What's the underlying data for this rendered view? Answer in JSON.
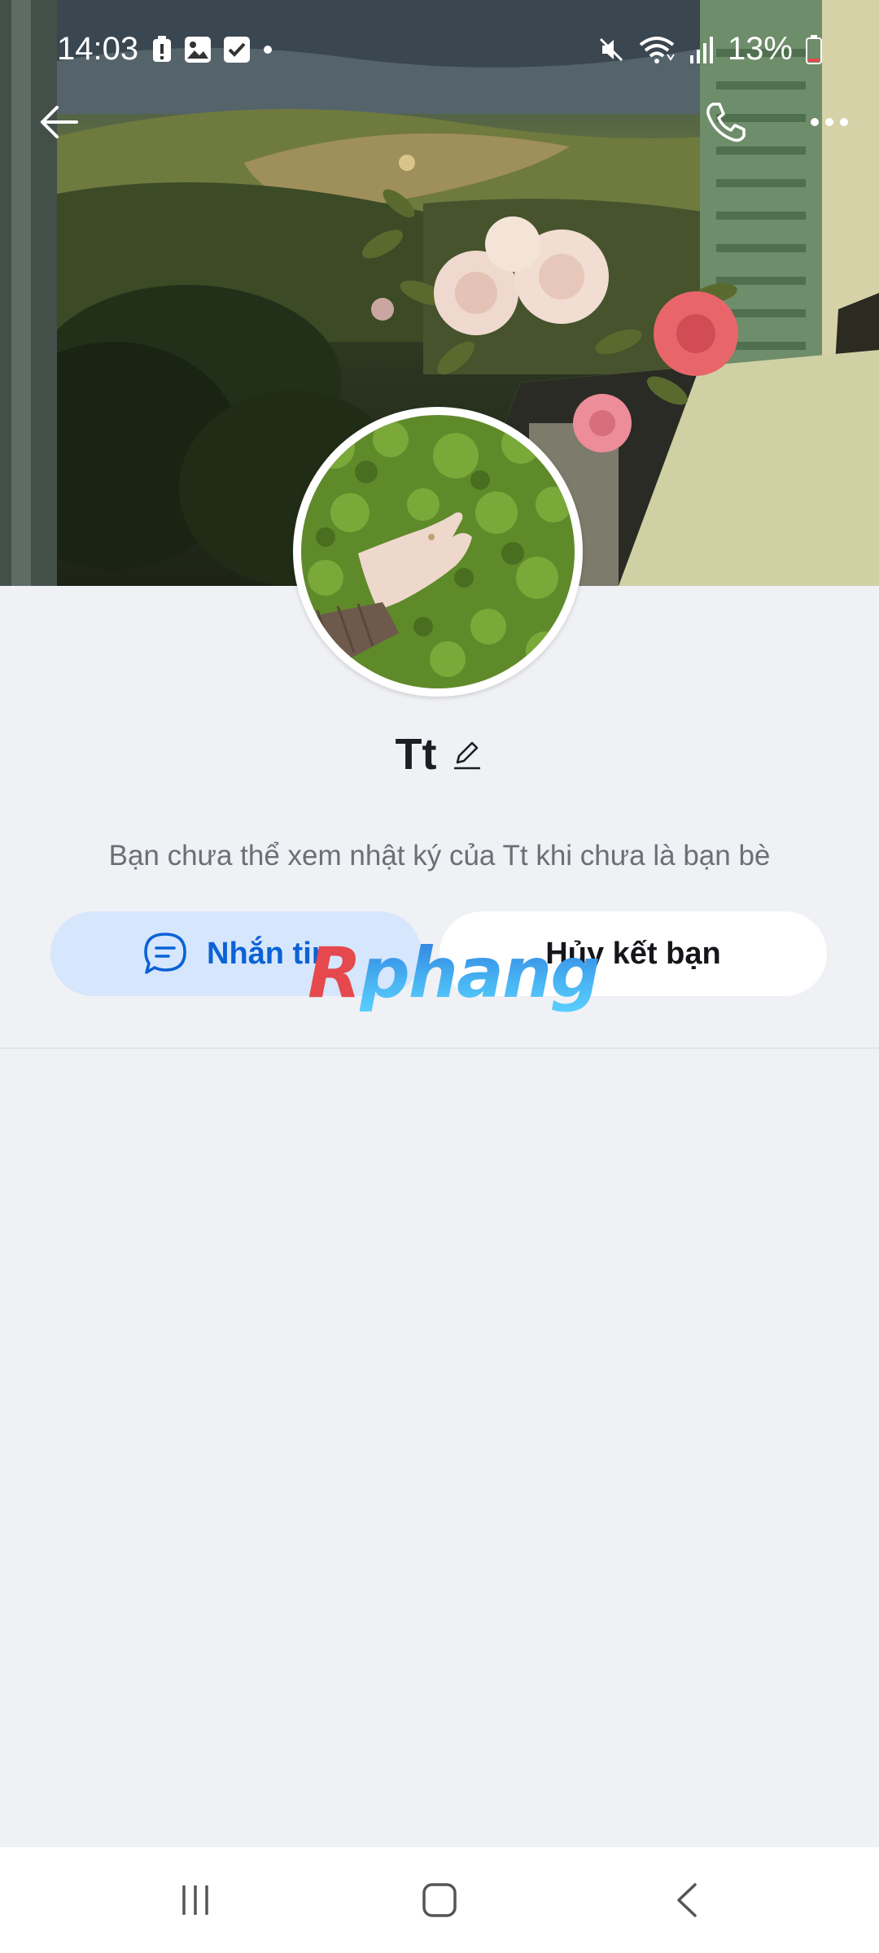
{
  "status_bar": {
    "time": "14:03",
    "battery_percent": "13%",
    "left_icons": [
      "battery-alert-icon",
      "gallery-icon",
      "checkbox-icon",
      "dot-icon"
    ],
    "right_icons": [
      "mute-icon",
      "wifi-icon",
      "signal-icon",
      "battery-icon"
    ]
  },
  "top_bar": {
    "back_icon": "back-arrow-icon",
    "call_icon": "phone-icon",
    "more_icon": "more-options-icon"
  },
  "profile": {
    "name": "Tt",
    "edit_icon": "pencil-icon",
    "timeline_notice": "Bạn chưa thể xem nhật ký của Tt khi chưa là bạn bè"
  },
  "actions": {
    "message_label": "Nhắn tin",
    "message_icon": "chat-bubble-icon",
    "unfriend_label": "Hủy kết bạn"
  },
  "watermark": {
    "part1": "R",
    "part2": "phang"
  },
  "nav_bar": {
    "icons": [
      "recent-apps-icon",
      "home-icon",
      "back-icon"
    ]
  },
  "colors": {
    "accent": "#0b62d6",
    "message_button_bg": "#d6e6fc",
    "page_bg": "#f0f1f5"
  }
}
